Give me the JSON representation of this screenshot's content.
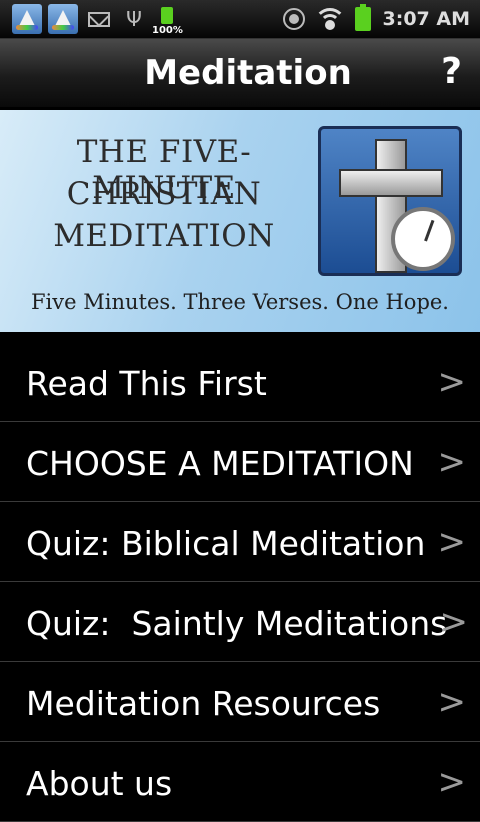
{
  "status_bar": {
    "battery_small_label": "100%",
    "time": "3:07 AM",
    "icons": [
      "app-icon",
      "app-icon",
      "mail-icon",
      "usb-icon",
      "battery-icon",
      "gps-icon",
      "wifi-icon",
      "battery-icon"
    ]
  },
  "header": {
    "title": "Meditation",
    "help_label": "?"
  },
  "banner": {
    "line1": "THE FIVE-MINUTE",
    "line2": "CHRISTIAN",
    "line3": "MEDITATION",
    "tagline": "Five Minutes. Three Verses. One Hope."
  },
  "menu": {
    "items": [
      {
        "label": "Read This First",
        "chevron": ">"
      },
      {
        "label": "CHOOSE A MEDITATION",
        "chevron": ">"
      },
      {
        "label": "Quiz: Biblical Meditation",
        "chevron": ">"
      },
      {
        "label": "Quiz:  Saintly Meditations",
        "chevron": ">"
      },
      {
        "label": "Meditation Resources",
        "chevron": ">"
      },
      {
        "label": "About us",
        "chevron": ">"
      }
    ]
  },
  "colors": {
    "battery_green": "#5ad01f",
    "banner_blue": "#a9d2ef",
    "chevron_gray": "#9a9a9a"
  }
}
